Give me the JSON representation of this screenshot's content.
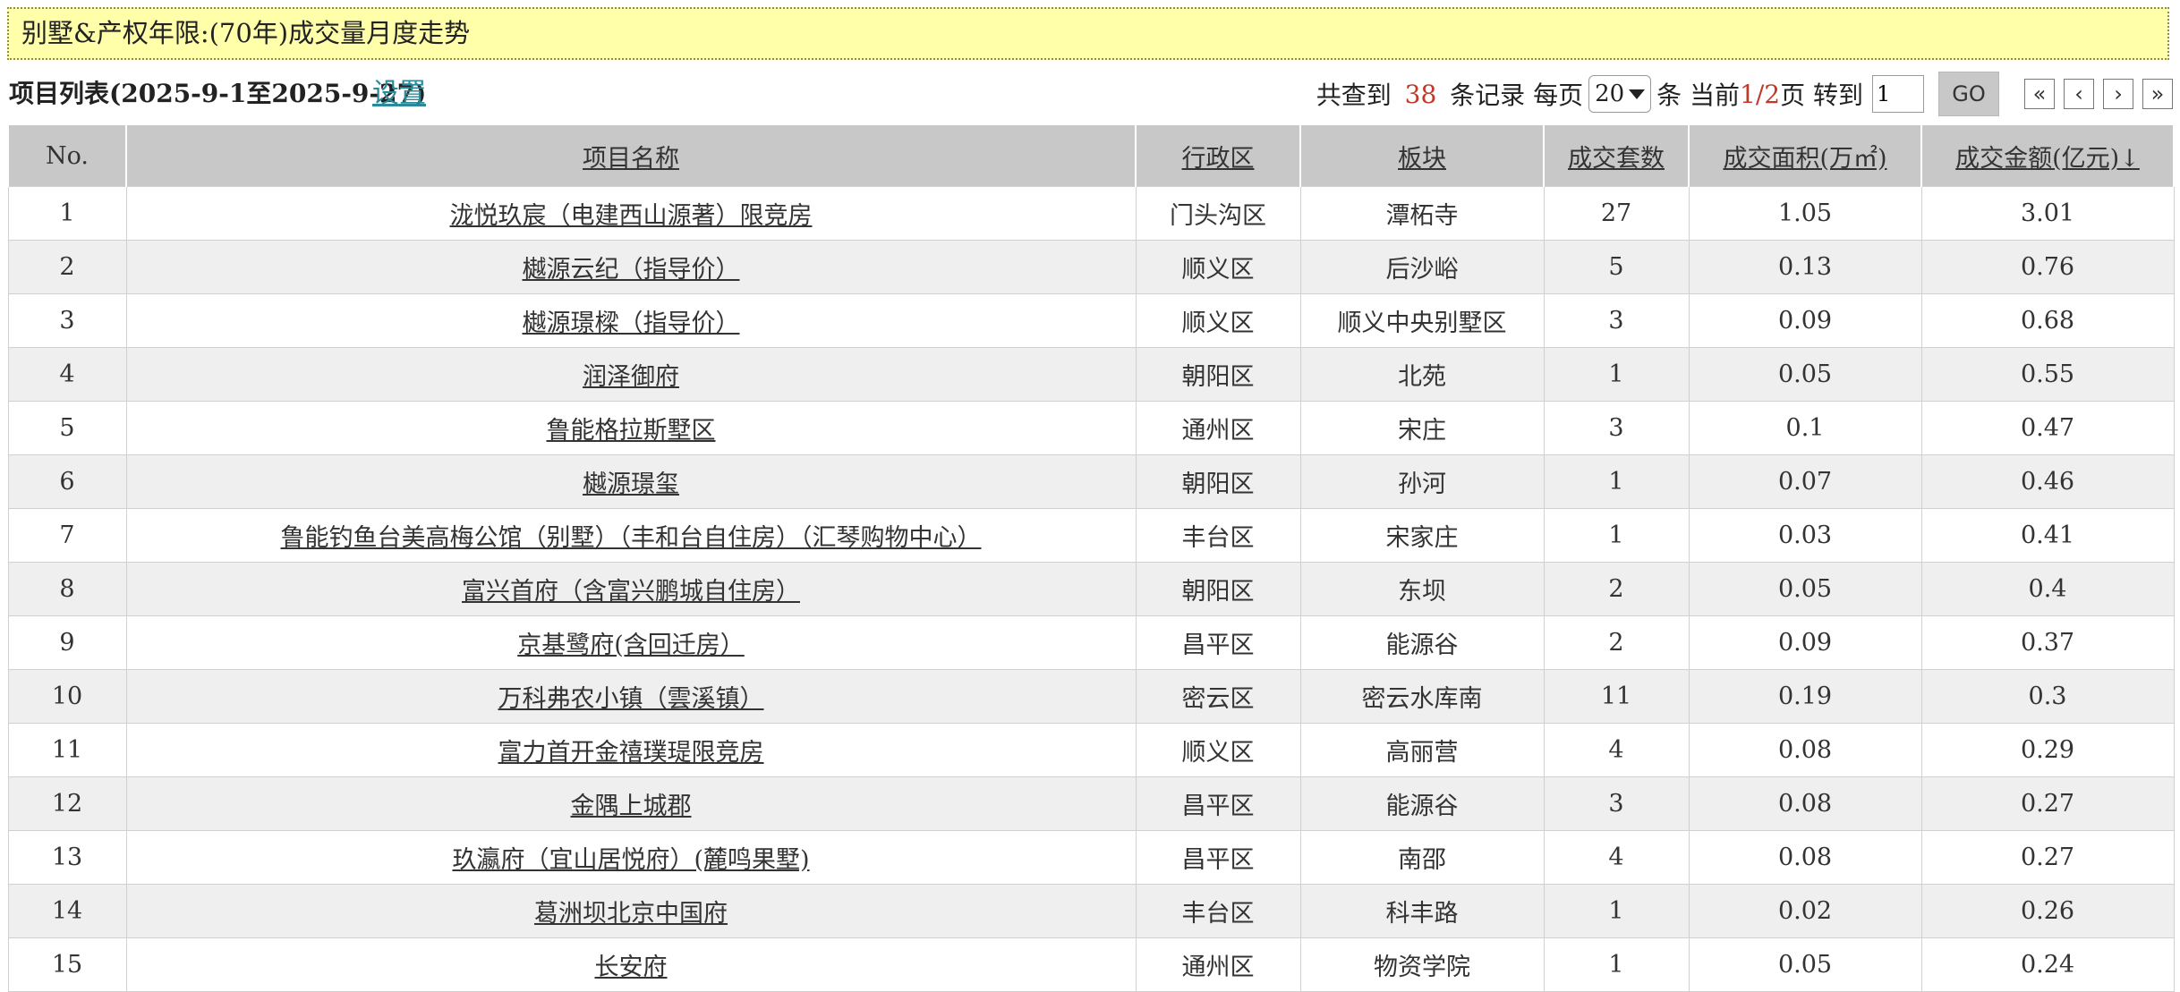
{
  "banner": {
    "title": "别墅&产权年限:(70年)成交量月度走势"
  },
  "toolbar": {
    "list_label": "项目列表(2025-9-1至2025-9-27)",
    "settings_label": "设置",
    "found_prefix": "共查到 ",
    "total_records": "38",
    "found_suffix": " 条记录 每页",
    "per_page": "20",
    "per_page_unit": "条 当前",
    "current_page": "1",
    "page_sep": "/",
    "total_pages": "2",
    "page_suffix": "页 转到",
    "goto_value": "1",
    "go_label": "GO",
    "first_icon": "«",
    "prev_icon": "‹",
    "next_icon": "›",
    "last_icon": "»"
  },
  "table": {
    "columns": [
      "No.",
      "项目名称",
      "行政区",
      "板块",
      "成交套数",
      "成交面积(万㎡)",
      "成交金额(亿元)↓"
    ],
    "rows": [
      [
        "1",
        "泷悦玖宸（电建西山源著）限竞房",
        "门头沟区",
        "潭柘寺",
        "27",
        "1.05",
        "3.01"
      ],
      [
        "2",
        "樾源云纪（指导价）",
        "顺义区",
        "后沙峪",
        "5",
        "0.13",
        "0.76"
      ],
      [
        "3",
        "樾源璟樑（指导价）",
        "顺义区",
        "顺义中央别墅区",
        "3",
        "0.09",
        "0.68"
      ],
      [
        "4",
        "润泽御府",
        "朝阳区",
        "北苑",
        "1",
        "0.05",
        "0.55"
      ],
      [
        "5",
        "鲁能格拉斯墅区",
        "通州区",
        "宋庄",
        "3",
        "0.1",
        "0.47"
      ],
      [
        "6",
        "樾源璟玺",
        "朝阳区",
        "孙河",
        "1",
        "0.07",
        "0.46"
      ],
      [
        "7",
        "鲁能钓鱼台美高梅公馆（别墅）（丰和台自住房）（汇琴购物中心）",
        "丰台区",
        "宋家庄",
        "1",
        "0.03",
        "0.41"
      ],
      [
        "8",
        "富兴首府（含富兴鹏城自住房）",
        "朝阳区",
        "东坝",
        "2",
        "0.05",
        "0.4"
      ],
      [
        "9",
        "京基鹭府(含回迁房）",
        "昌平区",
        "能源谷",
        "2",
        "0.09",
        "0.37"
      ],
      [
        "10",
        "万科弗农小镇（雲溪镇）",
        "密云区",
        "密云水库南",
        "11",
        "0.19",
        "0.3"
      ],
      [
        "11",
        "富力首开金禧璞瑅限竞房",
        "顺义区",
        "高丽营",
        "4",
        "0.08",
        "0.29"
      ],
      [
        "12",
        "金隅上城郡",
        "昌平区",
        "能源谷",
        "3",
        "0.08",
        "0.27"
      ],
      [
        "13",
        "玖瀛府（宜山居悦府）(麓鸣果墅)",
        "昌平区",
        "南邵",
        "4",
        "0.08",
        "0.27"
      ],
      [
        "14",
        "葛洲坝北京中国府",
        "丰台区",
        "科丰路",
        "1",
        "0.02",
        "0.26"
      ],
      [
        "15",
        "长安府",
        "通州区",
        "物资学院",
        "1",
        "0.05",
        "0.24"
      ]
    ]
  }
}
